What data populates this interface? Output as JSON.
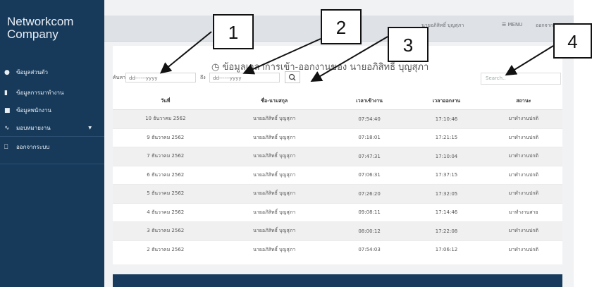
{
  "brand": {
    "line1": "Networkcom",
    "line2": "Company"
  },
  "sidebar": {
    "items": [
      {
        "label": "ข้อมูลส่วนตัว"
      },
      {
        "label": "ข้อมูลการมาทำงาน"
      },
      {
        "label": "ข้อมูลพนักงาน"
      },
      {
        "label": "มอบหมายงาน"
      },
      {
        "label": "ออกจากระบบ"
      }
    ]
  },
  "topbar": {
    "user": "นายอภิสิทธิ์ บุญสุภา",
    "menu": "MENU",
    "logout": "ออกจากระบบ"
  },
  "page": {
    "title": "ข้อมูลเวลาการเข้า-ออกงานของ นายอภิสิทธิ์ บุญสุภา"
  },
  "filter": {
    "from_label": "ค้นหา",
    "to_label": "ถึง",
    "date_placeholder": "dd------yyyy"
  },
  "table_search": {
    "placeholder": "Search.."
  },
  "table": {
    "headers": [
      "วันที่",
      "ชื่อ-นามสกุล",
      "เวลาเข้างาน",
      "เวลาออกงาน",
      "สถานะ"
    ],
    "rows": [
      [
        "10 ธันวาคม 2562",
        "นายอภิสิทธิ์ บุญสุภา",
        "07:54:40",
        "17:10:46",
        "มาทำงานปกติ"
      ],
      [
        "9 ธันวาคม 2562",
        "นายอภิสิทธิ์ บุญสุภา",
        "07:18:01",
        "17:21:15",
        "มาทำงานปกติ"
      ],
      [
        "7 ธันวาคม 2562",
        "นายอภิสิทธิ์ บุญสุภา",
        "07:47:31",
        "17:10:04",
        "มาทำงานปกติ"
      ],
      [
        "6 ธันวาคม 2562",
        "นายอภิสิทธิ์ บุญสุภา",
        "07:06:31",
        "17:37:15",
        "มาทำงานปกติ"
      ],
      [
        "5 ธันวาคม 2562",
        "นายอภิสิทธิ์ บุญสุภา",
        "07:26:20",
        "17:32:05",
        "มาทำงานปกติ"
      ],
      [
        "4 ธันวาคม 2562",
        "นายอภิสิทธิ์ บุญสุภา",
        "09:08:11",
        "17:14:46",
        "มาทำงานสาย"
      ],
      [
        "3 ธันวาคม 2562",
        "นายอภิสิทธิ์ บุญสุภา",
        "08:00:12",
        "17:22:08",
        "มาทำงานปกติ"
      ],
      [
        "2 ธันวาคม 2562",
        "นายอภิสิทธิ์ บุญสุภา",
        "07:54:03",
        "17:06:12",
        "มาทำงานปกติ"
      ]
    ]
  },
  "callouts": [
    "1",
    "2",
    "3",
    "4"
  ]
}
